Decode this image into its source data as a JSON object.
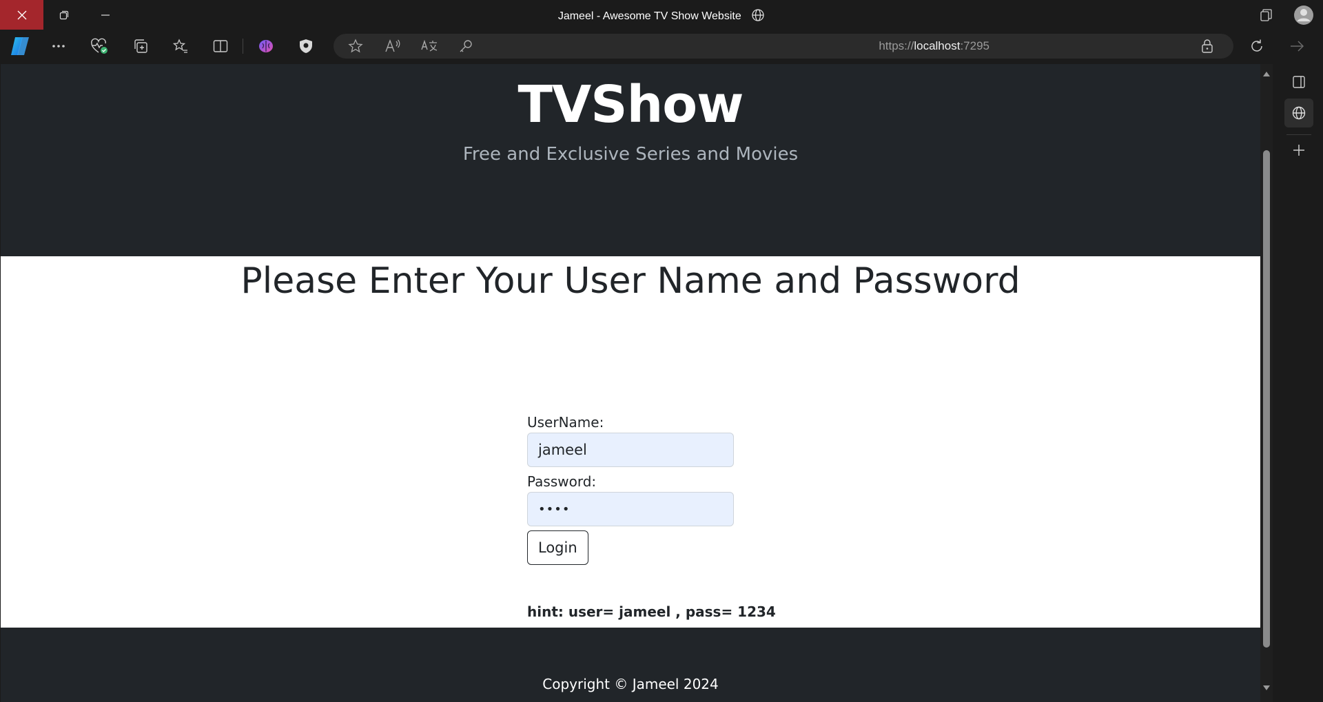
{
  "browser": {
    "window_title": "Jameel - Awesome TV Show Website",
    "url_scheme": "https://",
    "url_host": "localhost",
    "url_port": ":7295"
  },
  "header": {
    "site_title": "TVShow",
    "site_subtitle": "Free and Exclusive Series and Movies"
  },
  "main": {
    "heading": "Please Enter Your User Name and Password",
    "username_label": "UserName:",
    "username_value": "jameel",
    "password_label": "Password:",
    "password_value": "••••",
    "login_label": "Login",
    "hint": "hint: user= jameel , pass= 1234"
  },
  "footer": {
    "copyright": "Copyright © Jameel 2024"
  },
  "colors": {
    "page_dark": "#212529",
    "autofill": "#e8f0fe",
    "close_red": "#a4262c"
  }
}
